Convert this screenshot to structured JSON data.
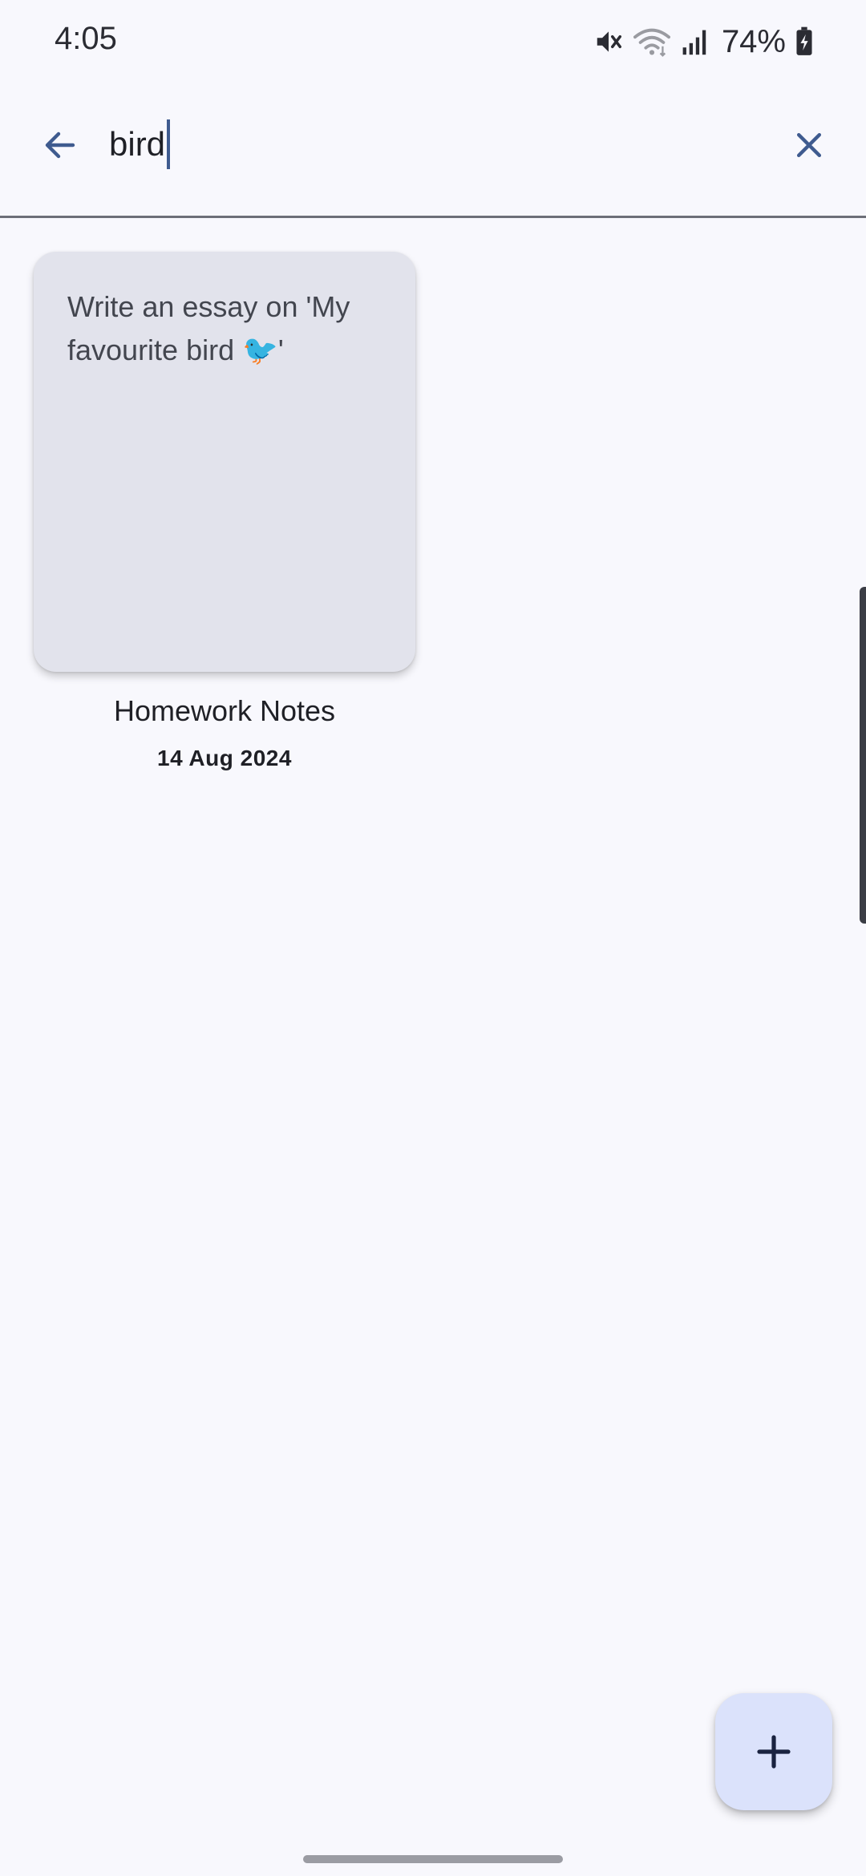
{
  "status_bar": {
    "time": "4:05",
    "battery": "74%",
    "icons": [
      "mute-icon",
      "wifi-icon",
      "signal-icon",
      "battery-charging-icon"
    ]
  },
  "search": {
    "value": "bird",
    "back_icon": "arrow-back-icon",
    "clear_icon": "close-icon"
  },
  "results": [
    {
      "preview": "Write an essay on 'My favourite bird 🐦'",
      "title": "Homework Notes",
      "date": "14 Aug 2024"
    }
  ],
  "fab": {
    "icon": "plus-icon"
  },
  "colors": {
    "background": "#f8f8fd",
    "card": "#e2e3ec",
    "accent": "#3f5b8f",
    "fab": "#dbe2fb"
  }
}
